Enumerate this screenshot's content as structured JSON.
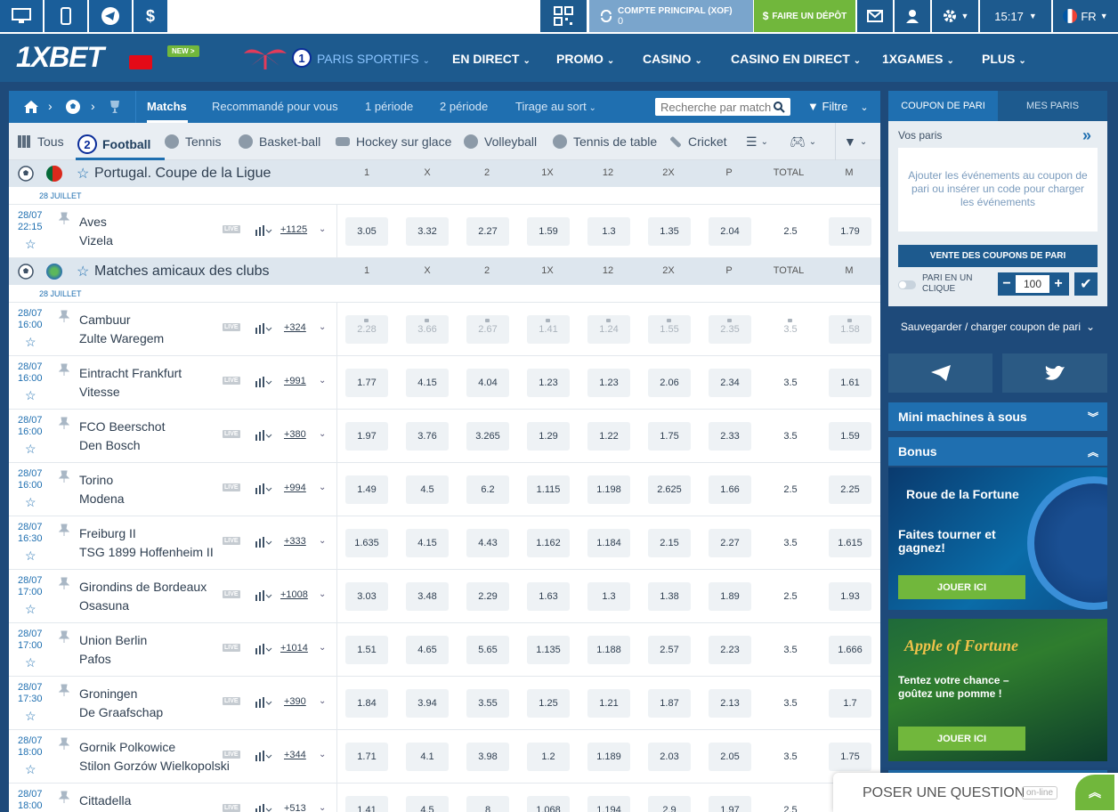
{
  "topbar": {
    "account_label": "COMPTE PRINCIPAL (XOF)",
    "account_value": "0",
    "deposit": "FAIRE UN DÉPÔT",
    "time": "15:17",
    "lang": "FR",
    "currency_symbol": "$"
  },
  "brand": {
    "logo": "1XBET",
    "new_badge": "NEW >"
  },
  "nav": {
    "items": [
      "PARIS SPORTIFS",
      "EN DIRECT",
      "PROMO",
      "CASINO",
      "CASINO EN DIRECT",
      "1XGAMES",
      "PLUS"
    ],
    "badge": "1"
  },
  "subtabs": {
    "items": [
      "Matchs",
      "Recommandé pour vous",
      "1 période",
      "2 période",
      "Tirage au sort"
    ],
    "search_placeholder": "Recherche par match",
    "filter": "Filtre"
  },
  "sports": {
    "badge": "2",
    "items": [
      "Tous",
      "Football",
      "Tennis",
      "Basket-ball",
      "Hockey sur glace",
      "Volleyball",
      "Tennis de table",
      "Cricket"
    ]
  },
  "columns": [
    "1",
    "X",
    "2",
    "1X",
    "12",
    "2X",
    "P",
    "TOTAL",
    "M"
  ],
  "leagues": [
    {
      "name": "Portugal. Coupe de la Ligue",
      "date": "28 JUILLET",
      "matches": [
        {
          "date": "28/07",
          "time": "22:15",
          "team1": "Aves",
          "team2": "Vizela",
          "count": "+1125",
          "odds": [
            "3.05",
            "3.32",
            "2.27",
            "1.59",
            "1.3",
            "1.35",
            "2.04",
            "2.5",
            "1.79"
          ],
          "locked": false
        }
      ]
    },
    {
      "name": "Matches amicaux des clubs",
      "date": "28 JUILLET",
      "matches": [
        {
          "date": "28/07",
          "time": "16:00",
          "team1": "Cambuur",
          "team2": "Zulte Waregem",
          "count": "+324",
          "odds": [
            "2.28",
            "3.66",
            "2.67",
            "1.41",
            "1.24",
            "1.55",
            "2.35",
            "3.5",
            "1.58"
          ],
          "locked": true
        },
        {
          "date": "28/07",
          "time": "16:00",
          "team1": "Eintracht Frankfurt",
          "team2": "Vitesse",
          "count": "+991",
          "odds": [
            "1.77",
            "4.15",
            "4.04",
            "1.23",
            "1.23",
            "2.06",
            "2.34",
            "3.5",
            "1.61"
          ],
          "locked": false
        },
        {
          "date": "28/07",
          "time": "16:00",
          "team1": "FCO Beerschot",
          "team2": "Den Bosch",
          "count": "+380",
          "odds": [
            "1.97",
            "3.76",
            "3.265",
            "1.29",
            "1.22",
            "1.75",
            "2.33",
            "3.5",
            "1.59"
          ],
          "locked": false
        },
        {
          "date": "28/07",
          "time": "16:00",
          "team1": "Torino",
          "team2": "Modena",
          "count": "+994",
          "odds": [
            "1.49",
            "4.5",
            "6.2",
            "1.115",
            "1.198",
            "2.625",
            "1.66",
            "2.5",
            "2.25"
          ],
          "locked": false
        },
        {
          "date": "28/07",
          "time": "16:30",
          "team1": "Freiburg II",
          "team2": "TSG 1899 Hoffenheim II",
          "count": "+333",
          "odds": [
            "1.635",
            "4.15",
            "4.43",
            "1.162",
            "1.184",
            "2.15",
            "2.27",
            "3.5",
            "1.615"
          ],
          "locked": false
        },
        {
          "date": "28/07",
          "time": "17:00",
          "team1": "Girondins de Bordeaux",
          "team2": "Osasuna",
          "count": "+1008",
          "odds": [
            "3.03",
            "3.48",
            "2.29",
            "1.63",
            "1.3",
            "1.38",
            "1.89",
            "2.5",
            "1.93"
          ],
          "locked": false
        },
        {
          "date": "28/07",
          "time": "17:00",
          "team1": "Union Berlin",
          "team2": "Pafos",
          "count": "+1014",
          "odds": [
            "1.51",
            "4.65",
            "5.65",
            "1.135",
            "1.188",
            "2.57",
            "2.23",
            "3.5",
            "1.666"
          ],
          "locked": false
        },
        {
          "date": "28/07",
          "time": "17:30",
          "team1": "Groningen",
          "team2": "De Graafschap",
          "count": "+390",
          "odds": [
            "1.84",
            "3.94",
            "3.55",
            "1.25",
            "1.21",
            "1.87",
            "2.13",
            "3.5",
            "1.7"
          ],
          "locked": false
        },
        {
          "date": "28/07",
          "time": "18:00",
          "team1": "Gornik Polkowice",
          "team2": "Stilon Gorzów Wielkopolski",
          "count": "+344",
          "odds": [
            "1.71",
            "4.1",
            "3.98",
            "1.2",
            "1.189",
            "2.03",
            "2.05",
            "3.5",
            "1.75"
          ],
          "locked": false
        },
        {
          "date": "28/07",
          "time": "18:00",
          "team1": "Cittadella",
          "team2": "",
          "count": "+513",
          "odds": [
            "1.41",
            "4.5",
            "8",
            "1.068",
            "1.194",
            "2.9",
            "1.97",
            "2.5",
            ""
          ],
          "locked": false
        }
      ]
    }
  ],
  "live_tag": "LIVE",
  "coupon": {
    "tab1": "COUPON DE PARI",
    "tab2": "MES PARIS",
    "your_bets": "Vos paris",
    "empty_text": "Ajouter les événements au coupon de pari ou insérer un code pour charger les événements",
    "sale_button": "VENTE DES COUPONS DE PARI",
    "one_click": "PARI EN UN CLIQUE",
    "stake": "100",
    "save_load": "Sauvegarder / charger coupon de pari"
  },
  "right": {
    "mini_slots": "Mini machines à sous",
    "bonus": "Bonus",
    "promo1_title": "Roue de la Fortune",
    "promo1_text": "Faites tourner et gagnez!",
    "promo1_button": "JOUER ICI",
    "promo2_title": "Apple of Fortune",
    "promo2_text": "Tentez votre chance – goûtez une pomme !",
    "promo2_button": "JOUER ICI"
  },
  "chat": {
    "label": "POSER UNE QUESTION",
    "status": "on-line"
  },
  "colors": {
    "brand_blue": "#1d5a8e",
    "deposit_green": "#71b73c",
    "accent_blue": "#1f6fb0"
  }
}
